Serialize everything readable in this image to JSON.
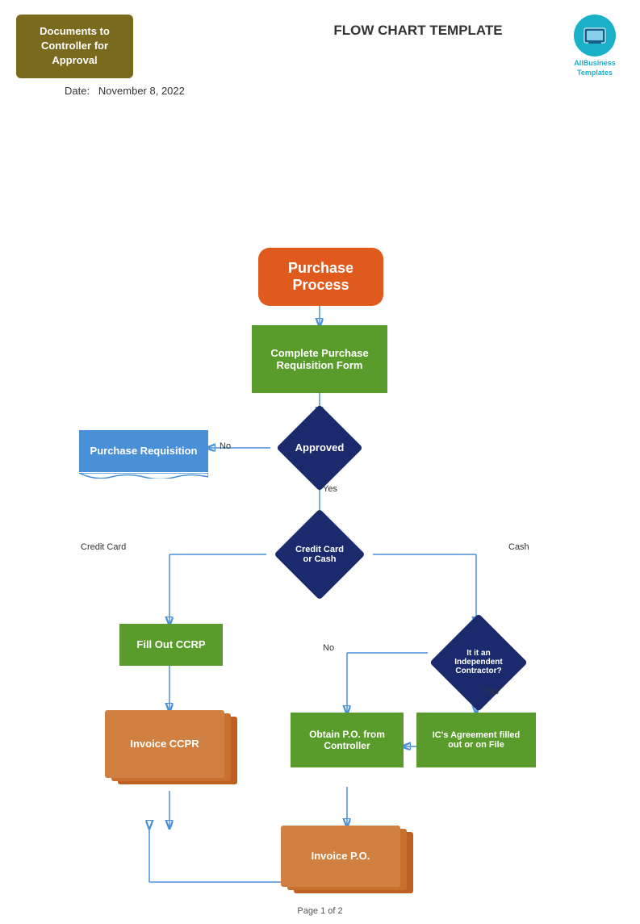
{
  "header": {
    "docs_box": "Documents to\nController for\nApproval",
    "title": "FLOW CHART TEMPLATE",
    "logo_text": "AllBusiness\nTemplates",
    "date_label": "Date:",
    "date_value": "November 8, 2022"
  },
  "shapes": {
    "start": "Purchase\nProcess",
    "step1": "Complete Purchase\nRequisition Form",
    "diamond1": "Approved",
    "banner": "Purchase Requisition",
    "diamond2": "Credit Card or Cash",
    "step_ccrp": "Fill Out CCRP",
    "doc_ccrp": "Invoice CCPR",
    "diamond3": "It it an Independent\nContractor?",
    "step_po": "Obtain P.O. from\nController",
    "step_ic": "IC's Agreement filled\nout or on File",
    "doc_po": "Invoice P.O."
  },
  "labels": {
    "no1": "No",
    "yes1": "Yes",
    "credit_card": "Credit Card",
    "cash": "Cash",
    "no2": "No",
    "yes2": "Yes"
  },
  "footer": "Page 1 of 2"
}
